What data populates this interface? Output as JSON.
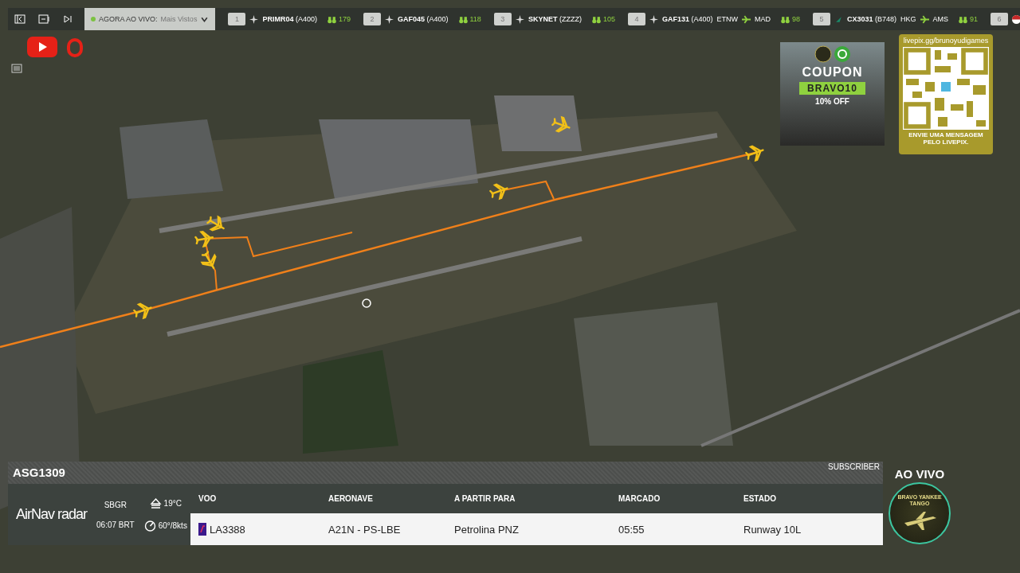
{
  "toolbar": {
    "dropdown": {
      "label": "AGORA AO VIVO:",
      "value": "Mais Vistos"
    }
  },
  "top_flights": [
    {
      "rank": "1",
      "callsign": "PRIMR04",
      "type": "(A400)",
      "viewers": "179"
    },
    {
      "rank": "2",
      "callsign": "GAF045",
      "type": "(A400)",
      "viewers": "118"
    },
    {
      "rank": "3",
      "callsign": "SKYNET",
      "type": "(ZZZZ)",
      "viewers": "105"
    },
    {
      "rank": "4",
      "callsign": "GAF131",
      "type": "(A400)",
      "origin": "ETNW",
      "destination": "MAD",
      "viewers": "98"
    },
    {
      "rank": "5",
      "callsign": "CX3031",
      "type": "(B748)",
      "origin": "HKG",
      "destination": "AMS",
      "viewers": "91"
    },
    {
      "rank": "6"
    }
  ],
  "coupon": {
    "title": "COUPON",
    "code": "BRAVO10",
    "discount": "10% OFF"
  },
  "livepix": {
    "url": "livepix.gg/brunoyudigames",
    "caption": "ENVIE UMA MENSAGEM PELO LIVEPIX."
  },
  "flight_panel": {
    "title": "ASG1309",
    "badge": "SUBSCRIBER",
    "brand": "AirNav radar",
    "airport": "SBGR",
    "time": "06:07 BRT",
    "temperature": "19°C",
    "wind": "60°/8kts",
    "columns": [
      "VOO",
      "AERONAVE",
      "A PARTIR PARA",
      "MARCADO",
      "ESTADO"
    ],
    "row": [
      "LA3388",
      "A21N - PS-LBE",
      "Petrolina PNZ",
      "05:55",
      "Runway 10L"
    ]
  },
  "live": {
    "label": "AO VIVO",
    "logo_text": "BRAVO YANKEE TANGO"
  }
}
